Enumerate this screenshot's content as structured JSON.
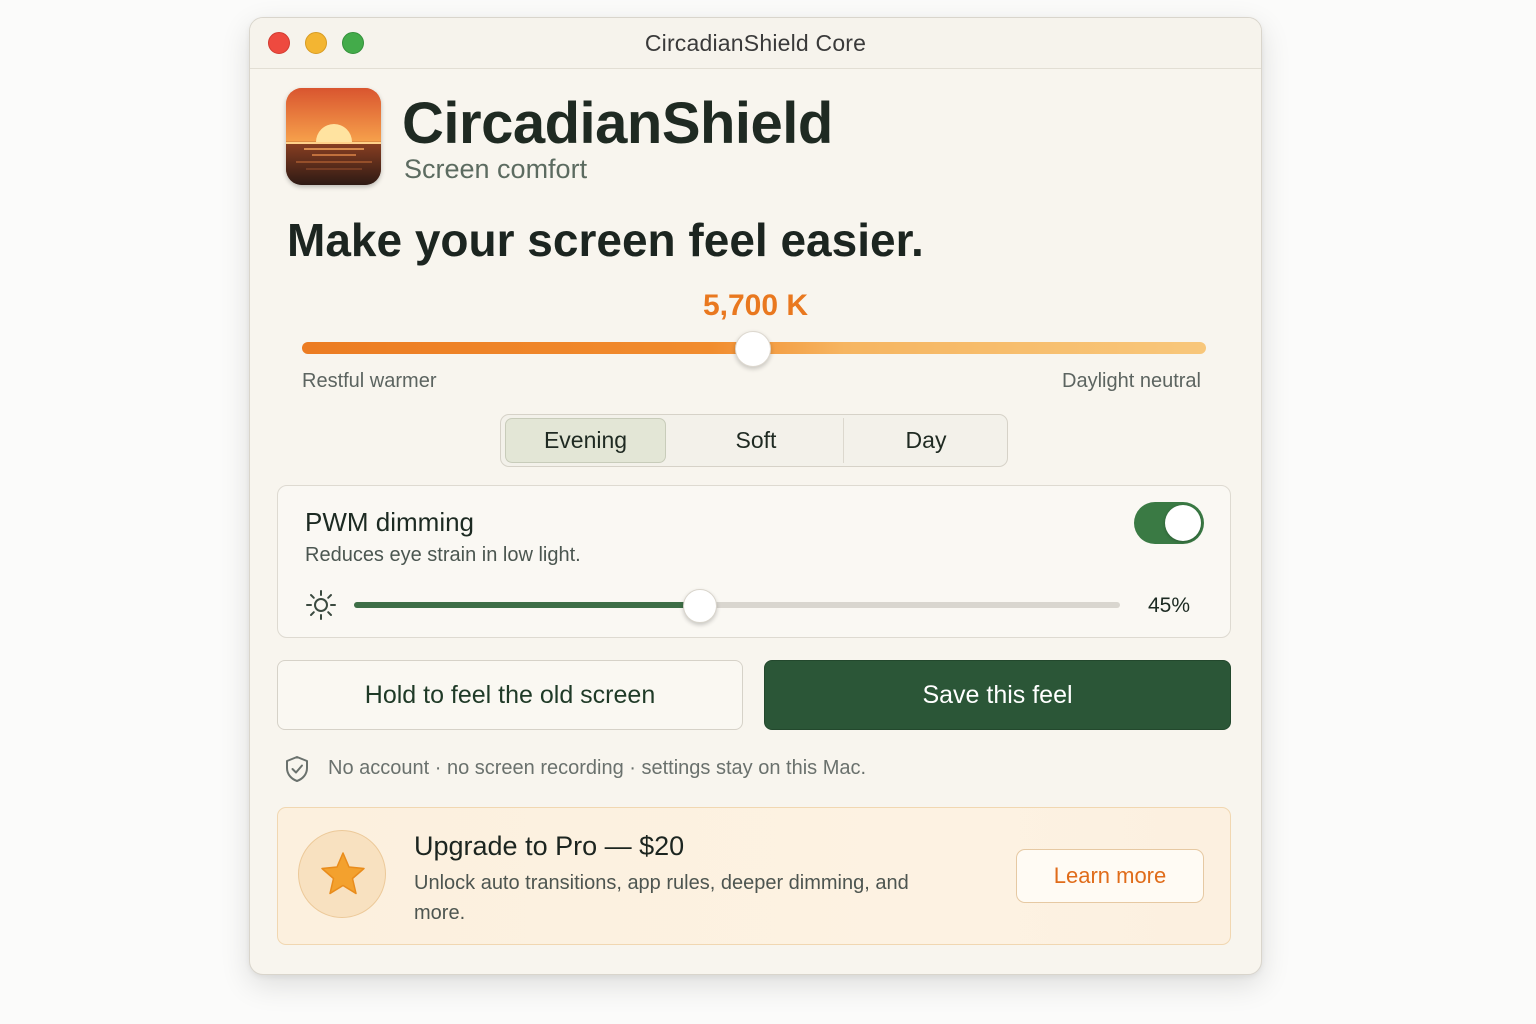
{
  "window": {
    "title": "CircadianShield Core"
  },
  "header": {
    "app_name": "CircadianShield",
    "subtitle": "Screen comfort",
    "icon": "sunset-app-icon"
  },
  "headline": "Make your screen feel easier.",
  "temperature": {
    "value_label": "5,700 K",
    "position_fraction": 0.5,
    "left_label": "Restful warmer",
    "right_label": "Daylight neutral"
  },
  "presets": {
    "selected": "Evening",
    "items": [
      "Evening",
      "Soft",
      "Day"
    ]
  },
  "pwm": {
    "title": "PWM dimming",
    "description": "Reduces eye strain in low light.",
    "enabled": true,
    "level_percent": 45,
    "level_label": "45%"
  },
  "actions": {
    "hold_label": "Hold to feel the old screen",
    "save_label": "Save this feel"
  },
  "privacy": {
    "text": "No account · no screen recording · settings stay on this Mac."
  },
  "promo": {
    "title": "Upgrade to Pro — $20",
    "description": "Unlock auto transitions, app rules, deeper dimming, and more.",
    "button_label": "Learn more"
  },
  "colors": {
    "accent_orange": "#e9781f",
    "primary_green": "#2b5637",
    "toggle_green": "#3a7a44",
    "window_bg": "#f8f5ee"
  }
}
